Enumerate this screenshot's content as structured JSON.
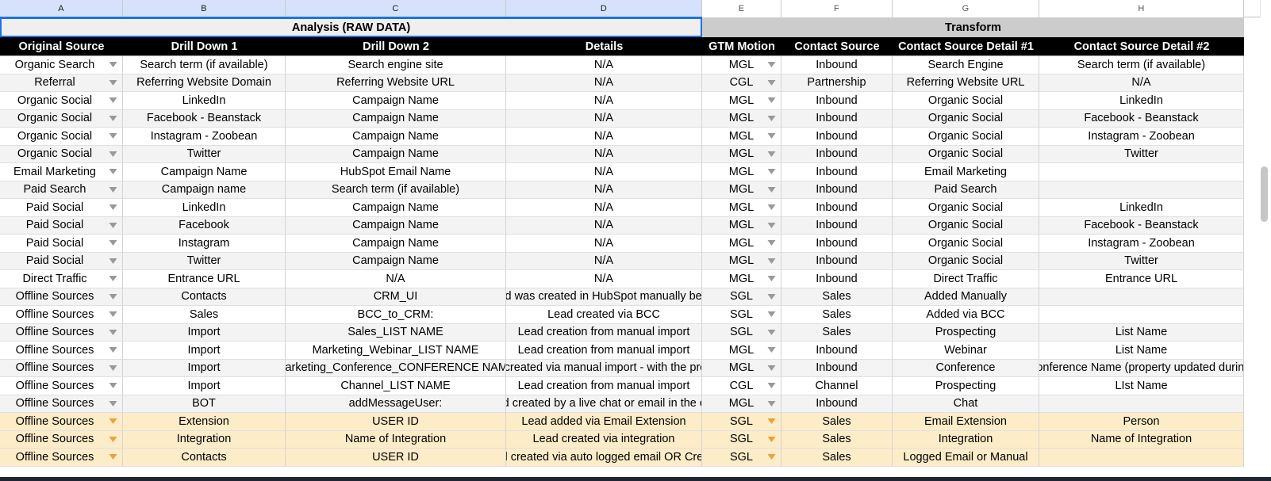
{
  "spreadsheet": {
    "column_letters": [
      "A",
      "B",
      "C",
      "D",
      "E",
      "F",
      "G",
      "H"
    ],
    "selected_columns": [
      "A",
      "B",
      "C",
      "D"
    ],
    "banner": {
      "analysis": "Analysis (RAW DATA)",
      "transform": "Transform"
    },
    "headers": [
      "Original Source",
      "Drill Down 1",
      "Drill Down 2",
      "Details",
      "GTM Motion",
      "Contact Source",
      "Contact Source Detail #1",
      "Contact Source Detail #2"
    ],
    "rows": [
      {
        "original_source": "Organic Search",
        "drill_down_1": "Search term (if available)",
        "drill_down_2": "Search engine site",
        "details": "N/A",
        "gtm_motion": "MGL",
        "contact_source": "Inbound",
        "contact_source_detail_1": "Search Engine",
        "contact_source_detail_2": "Search term (if available)",
        "highlight": false
      },
      {
        "original_source": "Referral",
        "drill_down_1": "Referring Website Domain",
        "drill_down_2": "Referring Website URL",
        "details": "N/A",
        "gtm_motion": "CGL",
        "contact_source": "Partnership",
        "contact_source_detail_1": "Referring Website URL",
        "contact_source_detail_2": "N/A",
        "highlight": false
      },
      {
        "original_source": "Organic Social",
        "drill_down_1": "LinkedIn",
        "drill_down_2": "Campaign Name",
        "details": "N/A",
        "gtm_motion": "MGL",
        "contact_source": "Inbound",
        "contact_source_detail_1": "Organic Social",
        "contact_source_detail_2": "LinkedIn",
        "highlight": false
      },
      {
        "original_source": "Organic Social",
        "drill_down_1": "Facebook - Beanstack",
        "drill_down_2": "Campaign Name",
        "details": "N/A",
        "gtm_motion": "MGL",
        "contact_source": "Inbound",
        "contact_source_detail_1": "Organic Social",
        "contact_source_detail_2": "Facebook - Beanstack",
        "highlight": false
      },
      {
        "original_source": "Organic Social",
        "drill_down_1": "Instagram - Zoobean",
        "drill_down_2": "Campaign Name",
        "details": "N/A",
        "gtm_motion": "MGL",
        "contact_source": "Inbound",
        "contact_source_detail_1": "Organic Social",
        "contact_source_detail_2": "Instagram - Zoobean",
        "highlight": false
      },
      {
        "original_source": "Organic Social",
        "drill_down_1": "Twitter",
        "drill_down_2": "Campaign Name",
        "details": "N/A",
        "gtm_motion": "MGL",
        "contact_source": "Inbound",
        "contact_source_detail_1": "Organic Social",
        "contact_source_detail_2": "Twitter",
        "highlight": false
      },
      {
        "original_source": "Email Marketing",
        "drill_down_1": "Campaign Name",
        "drill_down_2": "HubSpot Email Name",
        "details": "N/A",
        "gtm_motion": "MGL",
        "contact_source": "Inbound",
        "contact_source_detail_1": "Email Marketing",
        "contact_source_detail_2": "",
        "highlight": false
      },
      {
        "original_source": "Paid Search",
        "drill_down_1": "Campaign name",
        "drill_down_2": "Search term (if available)",
        "details": "N/A",
        "gtm_motion": "MGL",
        "contact_source": "Inbound",
        "contact_source_detail_1": "Paid Search",
        "contact_source_detail_2": "",
        "highlight": false
      },
      {
        "original_source": "Paid Social",
        "drill_down_1": "LinkedIn",
        "drill_down_2": "Campaign Name",
        "details": "N/A",
        "gtm_motion": "MGL",
        "contact_source": "Inbound",
        "contact_source_detail_1": "Organic Social",
        "contact_source_detail_2": "LinkedIn",
        "highlight": false
      },
      {
        "original_source": "Paid Social",
        "drill_down_1": "Facebook",
        "drill_down_2": "Campaign Name",
        "details": "N/A",
        "gtm_motion": "MGL",
        "contact_source": "Inbound",
        "contact_source_detail_1": "Organic Social",
        "contact_source_detail_2": "Facebook - Beanstack",
        "highlight": false
      },
      {
        "original_source": "Paid Social",
        "drill_down_1": "Instagram",
        "drill_down_2": "Campaign Name",
        "details": "N/A",
        "gtm_motion": "MGL",
        "contact_source": "Inbound",
        "contact_source_detail_1": "Organic Social",
        "contact_source_detail_2": "Instagram - Zoobean",
        "highlight": false
      },
      {
        "original_source": "Paid Social",
        "drill_down_1": "Twitter",
        "drill_down_2": "Campaign Name",
        "details": "N/A",
        "gtm_motion": "MGL",
        "contact_source": "Inbound",
        "contact_source_detail_1": "Organic Social",
        "contact_source_detail_2": "Twitter",
        "highlight": false
      },
      {
        "original_source": "Direct Traffic",
        "drill_down_1": "Entrance URL",
        "drill_down_2": "N/A",
        "details": "N/A",
        "gtm_motion": "MGL",
        "contact_source": "Inbound",
        "contact_source_detail_1": "Direct Traffic",
        "contact_source_detail_2": "Entrance URL",
        "highlight": false
      },
      {
        "original_source": "Offline Sources",
        "drill_down_1": "Contacts",
        "drill_down_2": "CRM_UI",
        "details": "Lead was created in HubSpot manually before",
        "gtm_motion": "SGL",
        "contact_source": "Sales",
        "contact_source_detail_1": "Added Manually",
        "contact_source_detail_2": "",
        "highlight": false
      },
      {
        "original_source": "Offline Sources",
        "drill_down_1": "Sales",
        "drill_down_2": "BCC_to_CRM:",
        "details": "Lead created via BCC",
        "gtm_motion": "SGL",
        "contact_source": "Sales",
        "contact_source_detail_1": "Added via BCC",
        "contact_source_detail_2": "",
        "highlight": false
      },
      {
        "original_source": "Offline Sources",
        "drill_down_1": "Import",
        "drill_down_2": "Sales_LIST NAME",
        "details": "Lead creation from manual import",
        "gtm_motion": "SGL",
        "contact_source": "Sales",
        "contact_source_detail_1": "Prospecting",
        "contact_source_detail_2": "List Name",
        "highlight": false
      },
      {
        "original_source": "Offline Sources",
        "drill_down_1": "Import",
        "drill_down_2": "Marketing_Webinar_LIST NAME",
        "details": "Lead creation from manual import",
        "gtm_motion": "MGL",
        "contact_source": "Inbound",
        "contact_source_detail_1": "Webinar",
        "contact_source_detail_2": "List Name",
        "highlight": false
      },
      {
        "original_source": "Offline Sources",
        "drill_down_1": "Import",
        "drill_down_2": "Marketing_Conference_CONFERENCE NAME",
        "details": "Lead created via manual import - with the property",
        "gtm_motion": "MGL",
        "contact_source": "Inbound",
        "contact_source_detail_1": "Conference",
        "contact_source_detail_2": "Conference Name (property updated during)",
        "highlight": false
      },
      {
        "original_source": "Offline Sources",
        "drill_down_1": "Import",
        "drill_down_2": "Channel_LIST NAME",
        "details": "Lead creation from manual import",
        "gtm_motion": "CGL",
        "contact_source": "Channel",
        "contact_source_detail_1": "Prospecting",
        "contact_source_detail_2": "LIst Name",
        "highlight": false
      },
      {
        "original_source": "Offline Sources",
        "drill_down_1": "BOT",
        "drill_down_2": "addMessageUser:",
        "details": "Lead created by a live chat or email in the conv",
        "gtm_motion": "MGL",
        "contact_source": "Inbound",
        "contact_source_detail_1": "Chat",
        "contact_source_detail_2": "",
        "highlight": false
      },
      {
        "original_source": "Offline Sources",
        "drill_down_1": "Extension",
        "drill_down_2": "USER ID",
        "details": "Lead added via Email Extension",
        "gtm_motion": "SGL",
        "contact_source": "Sales",
        "contact_source_detail_1": "Email Extension",
        "contact_source_detail_2": "Person",
        "highlight": true
      },
      {
        "original_source": "Offline Sources",
        "drill_down_1": "Integration",
        "drill_down_2": "Name of Integration",
        "details": "Lead created via integration",
        "gtm_motion": "SGL",
        "contact_source": "Sales",
        "contact_source_detail_1": "Integration",
        "contact_source_detail_2": "Name of Integration",
        "highlight": true
      },
      {
        "original_source": "Offline Sources",
        "drill_down_1": "Contacts",
        "drill_down_2": "USER ID",
        "details": "Lead created via auto logged email OR Created",
        "gtm_motion": "SGL",
        "contact_source": "Sales",
        "contact_source_detail_1": "Logged Email or Manual",
        "contact_source_detail_2": "",
        "highlight": true
      }
    ],
    "colors": {
      "selection_accent": "#1a73e8",
      "header_background": "#000000",
      "header_text": "#ffffff",
      "banner_transform_background": "#cccccc",
      "banner_analysis_background": "#efefef",
      "highlight_row_background": "#fdecc8",
      "alt_row_background": "#f3f3f3",
      "dropdown_arrow": "#999999",
      "dropdown_arrow_highlight": "#e8a33d"
    }
  }
}
